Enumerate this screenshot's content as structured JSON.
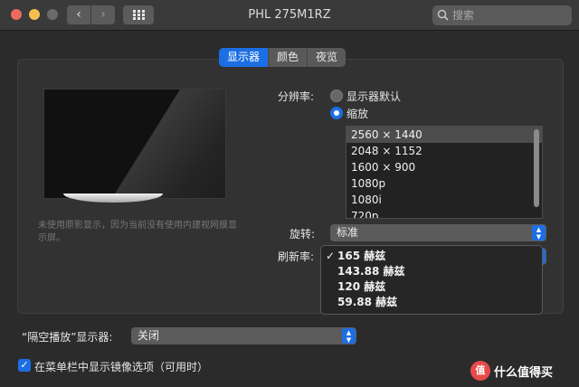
{
  "window": {
    "title": "PHL 275M1RZ",
    "back_glyph": "‹",
    "forward_glyph": "›"
  },
  "search": {
    "placeholder": "搜索"
  },
  "tabs": [
    {
      "label": "显示器",
      "active": true
    },
    {
      "label": "颜色",
      "active": false
    },
    {
      "label": "夜览",
      "active": false
    }
  ],
  "preview": {
    "note": "未使用原影显示，因为当前没有使用内建视网膜显示屏。"
  },
  "resolution": {
    "label": "分辨率:",
    "option_default": "显示器默认",
    "option_scaled": "缩放",
    "selected_option": "缩放",
    "list": [
      "2560 × 1440",
      "2048 × 1152",
      "1600 × 900",
      "1080p",
      "1080i",
      "720p"
    ],
    "selected_item": "2560 × 1440"
  },
  "rotation": {
    "label": "旋转:",
    "value": "标准"
  },
  "refresh": {
    "label": "刷新率:",
    "check_glyph": "✓",
    "options": [
      "165 赫兹",
      "143.88 赫兹",
      "120 赫兹",
      "59.88 赫兹"
    ],
    "selected": "165 赫兹"
  },
  "airplay": {
    "label": "“隔空播放”显示器:",
    "value": "关闭"
  },
  "mirror_option": {
    "label": "在菜单栏中显示镜像选项（可用时）",
    "checked": true
  },
  "watermark": {
    "logo": "值",
    "text": "什么值得买"
  },
  "colors": {
    "accent": "#1c6ee4",
    "window_bg": "#2b2b2b",
    "close": "#ed6a5e",
    "minimize": "#f5bf4f"
  }
}
